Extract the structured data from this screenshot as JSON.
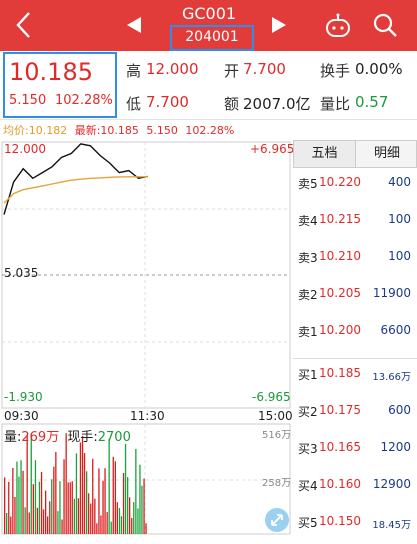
{
  "header": {
    "title": "GC001",
    "subcode": "204001",
    "icons": [
      "back-arrow-icon",
      "prev-triangle-icon",
      "next-triangle-icon",
      "robot-icon",
      "search-icon"
    ],
    "bg_color": "#e23c3a"
  },
  "quote": {
    "price": "10.185",
    "change": "5.150",
    "change_pct": "102.28%",
    "high_label": "高",
    "high": "12.000",
    "open_label": "开",
    "open": "7.700",
    "turnover_label": "换手",
    "turnover": "0.00%",
    "low_label": "低",
    "low": "7.700",
    "amount_label": "额",
    "amount": "2007.0亿",
    "ratio_label": "量比",
    "ratio": "0.57"
  },
  "avg_line": {
    "avg_label": "均价:10.182",
    "latest_label": "最新:10.185",
    "change": "5.150",
    "change_pct": "102.28%"
  },
  "chart": {
    "y_top": "12.000",
    "y_mid": "5.035",
    "y_bottom": "-1.930",
    "pct_top": "+6.965",
    "pct_bottom": "-6.965",
    "x_start": "09:30",
    "x_mid": "11:30",
    "x_end": "15:00",
    "volume_label": "量:",
    "volume_value": "269万",
    "current_label": "现手:",
    "current_value": "2700",
    "vol_top": "516万",
    "vol_mid": "258万"
  },
  "chart_data": {
    "type": "line",
    "title": "",
    "x_start": "09:30",
    "x_end": "15:00",
    "series": [
      {
        "values": [
          8.2,
          9.9,
          10.6,
          10.1,
          10.4,
          10.7,
          11.2,
          11.4,
          11.9,
          11.8,
          11.3,
          10.9,
          10.4,
          10.5,
          10.1,
          10.2
        ]
      },
      {
        "values": [
          8.8,
          9.3,
          9.5,
          9.6,
          9.7,
          9.8,
          9.9,
          10.0,
          10.05,
          10.1,
          10.12,
          10.15,
          10.17,
          10.18,
          10.18,
          10.18
        ]
      }
    ],
    "ylim": [
      -1.93,
      12.0
    ]
  },
  "orderbook": {
    "tabs": [
      "五档",
      "明细"
    ],
    "asks": [
      {
        "name": "卖5",
        "price": "10.220",
        "vol": "400"
      },
      {
        "name": "卖4",
        "price": "10.215",
        "vol": "100"
      },
      {
        "name": "卖3",
        "price": "10.210",
        "vol": "100"
      },
      {
        "name": "卖2",
        "price": "10.205",
        "vol": "11900"
      },
      {
        "name": "卖1",
        "price": "10.200",
        "vol": "6600"
      }
    ],
    "bids": [
      {
        "name": "买1",
        "price": "10.185",
        "vol": "13.66万"
      },
      {
        "name": "买2",
        "price": "10.175",
        "vol": "600"
      },
      {
        "name": "买3",
        "price": "10.165",
        "vol": "1200"
      },
      {
        "name": "买4",
        "price": "10.160",
        "vol": "12900"
      },
      {
        "name": "买5",
        "price": "10.150",
        "vol": "18.45万"
      }
    ]
  }
}
